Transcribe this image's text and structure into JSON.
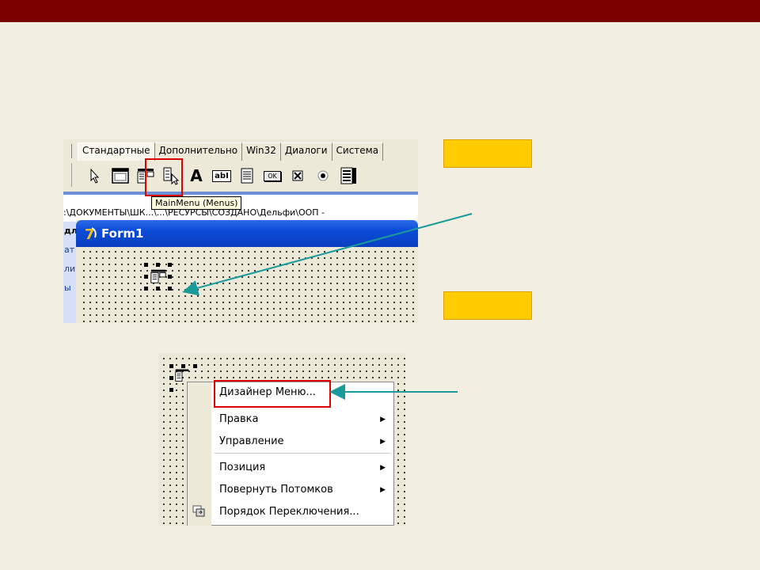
{
  "palette": {
    "tabs": [
      "Стандартные",
      "Дополнительно",
      "Win32",
      "Диалоги",
      "Система"
    ],
    "tooltip": "MainMenu (Menus)",
    "tools": [
      "pointer-icon",
      "frames-icon",
      "mainmenu-icon",
      "popupmenu-icon",
      "label-icon",
      "edit-icon",
      "memo-icon",
      "button-icon",
      "checkbox-icon",
      "radiobutton-icon",
      "listbox-icon"
    ],
    "labels": {
      "label_glyph": "A",
      "edit_glyph": "abI",
      "button_glyph": "OK"
    }
  },
  "pathbar": {
    "text": ":\\ДОКУМЕНТЫ\\ШК...\\...\\РЕСУРСЫ\\СОЗДАНО\\Дельфи\\ООП -"
  },
  "leftpane": {
    "items": [
      "дл",
      "ат",
      "ли",
      "ы"
    ]
  },
  "form": {
    "title": "Form1"
  },
  "context_menu": {
    "items": [
      {
        "label": "Дизайнер Меню...",
        "submenu": false
      },
      {
        "label": "Правка",
        "submenu": true
      },
      {
        "label": "Управление",
        "submenu": true
      },
      {
        "label": "Позиция",
        "submenu": true
      },
      {
        "label": "Повернуть Потомков",
        "submenu": true
      },
      {
        "label": "Порядок Переключения...",
        "submenu": false
      }
    ],
    "submenu_glyph": "▶"
  },
  "colors": {
    "top_bar": "#7b0000",
    "background": "#f2eee1",
    "highlight": "#e00000",
    "arrow": "#1a9a9a",
    "label_box": "#ffcc00"
  }
}
